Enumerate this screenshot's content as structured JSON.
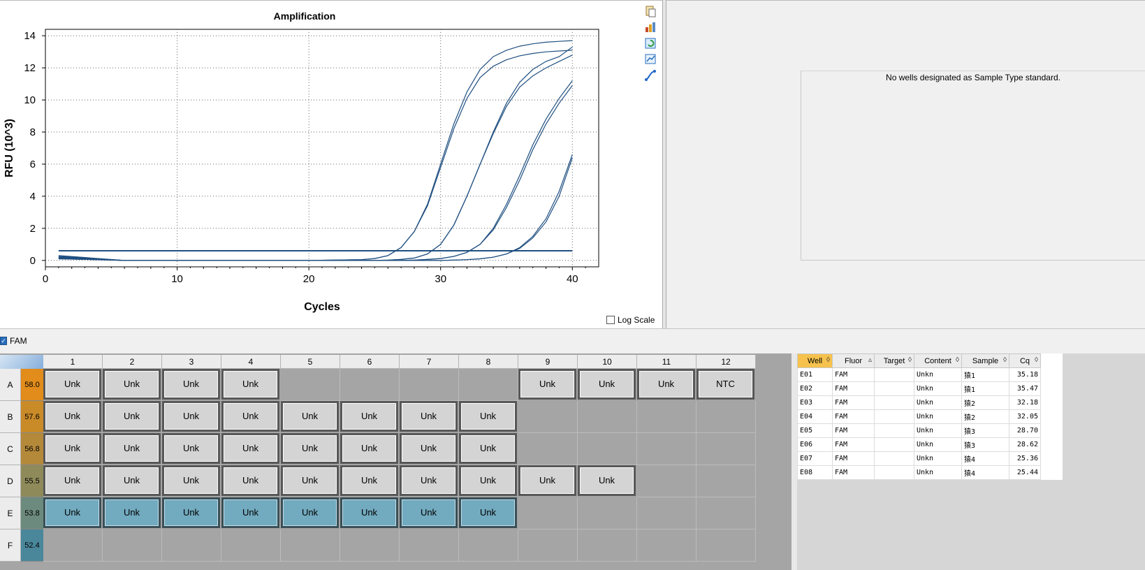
{
  "chart": {
    "chart_data": {
      "type": "line",
      "title": "Amplification",
      "xlabel": "Cycles",
      "ylabel": "RFU (10^3)",
      "xlim": [
        0,
        42
      ],
      "ylim": [
        -0.4,
        14.4
      ],
      "xticks": [
        0,
        10,
        20,
        30,
        40
      ],
      "yticks": [
        0,
        2,
        4,
        6,
        8,
        10,
        12,
        14
      ],
      "grid": "dotted",
      "threshold": 0.6,
      "x": [
        1,
        6,
        10,
        15,
        20,
        24,
        25,
        26,
        27,
        28,
        29,
        30,
        31,
        32,
        33,
        34,
        35,
        36,
        37,
        38,
        39,
        40
      ],
      "series": [
        {
          "values": [
            0.3,
            0,
            0,
            0,
            0,
            0.05,
            0.12,
            0.3,
            0.8,
            1.8,
            3.5,
            6.0,
            8.5,
            10.5,
            11.9,
            12.7,
            13.1,
            13.35,
            13.5,
            13.6,
            13.65,
            13.7
          ]
        },
        {
          "values": [
            0.25,
            0,
            0,
            0,
            0,
            0.05,
            0.12,
            0.3,
            0.8,
            1.8,
            3.4,
            5.8,
            8.2,
            10.1,
            11.4,
            12.1,
            12.5,
            12.75,
            12.9,
            13.0,
            13.05,
            13.1
          ]
        },
        {
          "values": [
            0.2,
            0,
            0,
            0,
            0,
            0,
            0,
            0.02,
            0.06,
            0.15,
            0.4,
            1.0,
            2.2,
            4.0,
            6.0,
            8.0,
            9.8,
            11.1,
            11.9,
            12.4,
            12.7,
            13.3
          ]
        },
        {
          "values": [
            0.2,
            0,
            0,
            0,
            0,
            0,
            0,
            0.02,
            0.06,
            0.15,
            0.4,
            1.0,
            2.2,
            4.0,
            6.0,
            7.9,
            9.6,
            10.8,
            11.5,
            12.0,
            12.4,
            12.8
          ]
        },
        {
          "values": [
            0.15,
            0,
            0,
            0,
            0,
            0,
            0,
            0,
            0,
            0.02,
            0.06,
            0.12,
            0.25,
            0.5,
            1.0,
            2.0,
            3.5,
            5.3,
            7.2,
            8.8,
            10.1,
            11.2
          ]
        },
        {
          "values": [
            0.15,
            0,
            0,
            0,
            0,
            0,
            0,
            0,
            0,
            0.02,
            0.06,
            0.12,
            0.25,
            0.5,
            1.0,
            1.9,
            3.3,
            5.0,
            6.9,
            8.5,
            9.8,
            10.9
          ]
        },
        {
          "values": [
            0.1,
            0,
            0,
            0,
            0,
            0,
            0,
            0,
            0,
            0,
            0,
            0,
            0.02,
            0.05,
            0.1,
            0.2,
            0.4,
            0.8,
            1.5,
            2.6,
            4.3,
            6.6
          ]
        },
        {
          "values": [
            0.1,
            0,
            0,
            0,
            0,
            0,
            0,
            0,
            0,
            0,
            0,
            0,
            0.02,
            0.05,
            0.1,
            0.2,
            0.4,
            0.75,
            1.4,
            2.4,
            4.0,
            6.4
          ]
        }
      ]
    },
    "log_scale_label": "Log Scale",
    "toolbar_icons": [
      "copy-icon",
      "export-chart-icon",
      "refresh-icon",
      "zoom-chart-icon",
      "curve-icon"
    ],
    "line_color": "#1f4f80"
  },
  "standard_curve": {
    "message": "No wells designated as Sample Type standard."
  },
  "fluor": {
    "label": "FAM",
    "checked": true
  },
  "plate": {
    "columns": [
      "1",
      "2",
      "3",
      "4",
      "5",
      "6",
      "7",
      "8",
      "9",
      "10",
      "11",
      "12"
    ],
    "rows": [
      {
        "label": "A",
        "temp": "58.0",
        "color": "#e18c1b",
        "wells": [
          "Unk",
          "Unk",
          "Unk",
          "Unk",
          "",
          "",
          "",
          "",
          "Unk",
          "Unk",
          "Unk",
          "NTC"
        ]
      },
      {
        "label": "B",
        "temp": "57.6",
        "color": "#c98a28",
        "wells": [
          "Unk",
          "Unk",
          "Unk",
          "Unk",
          "Unk",
          "Unk",
          "Unk",
          "Unk",
          "",
          "",
          "",
          ""
        ]
      },
      {
        "label": "C",
        "temp": "56.8",
        "color": "#b5893a",
        "wells": [
          "Unk",
          "Unk",
          "Unk",
          "Unk",
          "Unk",
          "Unk",
          "Unk",
          "Unk",
          "",
          "",
          "",
          ""
        ]
      },
      {
        "label": "D",
        "temp": "55.5",
        "color": "#8e8a5a",
        "wells": [
          "Unk",
          "Unk",
          "Unk",
          "Unk",
          "Unk",
          "Unk",
          "Unk",
          "Unk",
          "Unk",
          "Unk",
          "",
          ""
        ]
      },
      {
        "label": "E",
        "temp": "53.8",
        "color": "#6c8a7d",
        "selected": true,
        "wells": [
          "Unk",
          "Unk",
          "Unk",
          "Unk",
          "Unk",
          "Unk",
          "Unk",
          "Unk",
          "",
          "",
          "",
          ""
        ]
      },
      {
        "label": "F",
        "temp": "52.4",
        "color": "#4a879b",
        "wells": [
          "",
          "",
          "",
          "",
          "",
          "",
          "",
          "",
          "",
          "",
          "",
          ""
        ]
      }
    ],
    "accent_selected": "#72aabf"
  },
  "results": {
    "headers": [
      "Well",
      "Fluor",
      "Target",
      "Content",
      "Sample",
      "Cq"
    ],
    "rows": [
      [
        "E01",
        "FAM",
        "",
        "Unkn",
        "猿1",
        "35.18"
      ],
      [
        "E02",
        "FAM",
        "",
        "Unkn",
        "猿1",
        "35.47"
      ],
      [
        "E03",
        "FAM",
        "",
        "Unkn",
        "猿2",
        "32.18"
      ],
      [
        "E04",
        "FAM",
        "",
        "Unkn",
        "猿2",
        "32.05"
      ],
      [
        "E05",
        "FAM",
        "",
        "Unkn",
        "猿3",
        "28.70"
      ],
      [
        "E06",
        "FAM",
        "",
        "Unkn",
        "猿3",
        "28.62"
      ],
      [
        "E07",
        "FAM",
        "",
        "Unkn",
        "猿4",
        "25.36"
      ],
      [
        "E08",
        "FAM",
        "",
        "Unkn",
        "猿4",
        "25.44"
      ]
    ]
  }
}
